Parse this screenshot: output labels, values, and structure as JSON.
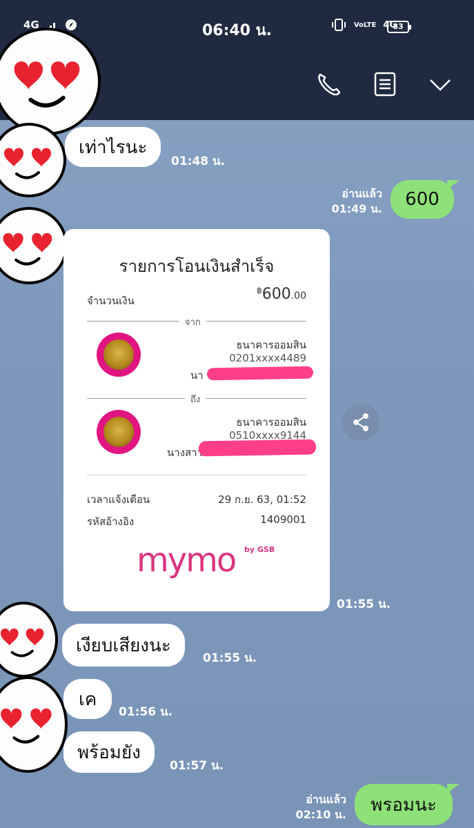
{
  "status_bar": {
    "network_left": "4G",
    "time": "06:40 น.",
    "network_right": "4G",
    "volte": "VoLTE",
    "battery": "83"
  },
  "header_icons": [
    "phone-icon",
    "notes-icon",
    "chevron-down-icon"
  ],
  "messages": [
    {
      "side": "left",
      "text": "เท่าไรนะ",
      "time": "01:48 น."
    },
    {
      "side": "right",
      "text": "600",
      "read": "อ่านแล้ว",
      "time": "01:49 น."
    },
    {
      "side": "left",
      "type": "slip",
      "time": "01:55 น."
    },
    {
      "side": "left",
      "text": "เงียบเสียงนะ",
      "time": "01:55 น."
    },
    {
      "side": "left",
      "text": "เค",
      "time": "01:56 น."
    },
    {
      "side": "left",
      "text": "พร้อมยัง",
      "time": "01:57 น."
    },
    {
      "side": "right",
      "text": "พรอมนะ",
      "read": "อ่านแล้ว",
      "time": "02:10 น."
    }
  ],
  "slip": {
    "title": "รายการโอนเงินสำเร็จ",
    "amount_label": "จำนวนเงิน",
    "amount_currency": "฿",
    "amount_main": "600",
    "amount_decimal": ".00",
    "from_label": "จาก",
    "to_label": "ถึง",
    "from_bank": "ธนาคารออมสิน",
    "from_account": "0201xxxx4489",
    "from_name_prefix": "นา",
    "to_bank": "ธนาคารออมสิน",
    "to_account": "0510xxxx9144",
    "to_name_prefix": "นางสาว",
    "notify_label": "เวลาแจ้งเตือน",
    "notify_value": "29 ก.ย. 63, 01:52",
    "ref_label": "รหัสอ้างอิง",
    "ref_value": "1409001",
    "brand": "mymo",
    "brand_by": "by GSB"
  },
  "colors": {
    "header": "#1f2a40",
    "background": "#7f99bd",
    "bubble_out": "#8ee178",
    "bubble_in": "#ffffff",
    "brand": "#e0157f",
    "redaction": "#ff3e8a"
  }
}
